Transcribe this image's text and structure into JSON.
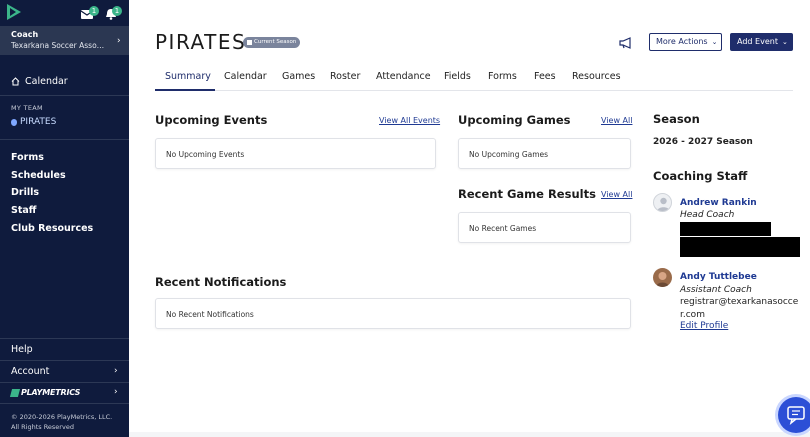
{
  "sidebar": {
    "notifications_badge": "1",
    "alerts_badge": "1",
    "coach_role": "Coach",
    "coach_org": "Texarkana Soccer Association",
    "calendar_label": "Calendar",
    "my_team_label": "MY TEAM",
    "team_name": "PIRATES",
    "menu": [
      "Forms",
      "Schedules",
      "Drills",
      "Staff",
      "Club Resources"
    ],
    "help_label": "Help",
    "account_label": "Account",
    "brand_name": "PLAYMETRICS",
    "copyright_line1": "© 2020-2026 PlayMetrics, LLC.",
    "copyright_line2": "All Rights Reserved"
  },
  "header": {
    "team_title": "PIRATES",
    "season_pill": "Current Season",
    "more_actions_label": "More Actions",
    "add_event_label": "Add Event"
  },
  "tabs": [
    "Summary",
    "Calendar",
    "Games",
    "Roster",
    "Attendance",
    "Fields",
    "Forms",
    "Fees",
    "Resources"
  ],
  "active_tab": "Summary",
  "upcoming_events": {
    "title": "Upcoming Events",
    "link": "View All Events",
    "empty": "No Upcoming Events"
  },
  "upcoming_games": {
    "title": "Upcoming Games",
    "link": "View All",
    "empty": "No Upcoming Games"
  },
  "recent_results": {
    "title": "Recent Game Results",
    "link": "View All",
    "empty": "No Recent Games"
  },
  "recent_notifications": {
    "title": "Recent Notifications",
    "empty": "No Recent Notifications"
  },
  "right_panel": {
    "season_title": "Season",
    "season_value": "2026 - 2027 Season",
    "staff_title": "Coaching Staff",
    "staff": [
      {
        "name": "Andrew Rankin",
        "role": "Head Coach"
      },
      {
        "name": "Andy Tuttlebee",
        "role": "Assistant Coach",
        "email": "registrar@texarkanasoccer.com"
      }
    ],
    "edit_profile": "Edit Profile"
  },
  "colors": {
    "sidebar_bg": "#0f1b3d",
    "accent": "#1f2d6b",
    "link": "#1f3a93",
    "badge": "#3bb58a",
    "chat": "#2c4fd6"
  }
}
